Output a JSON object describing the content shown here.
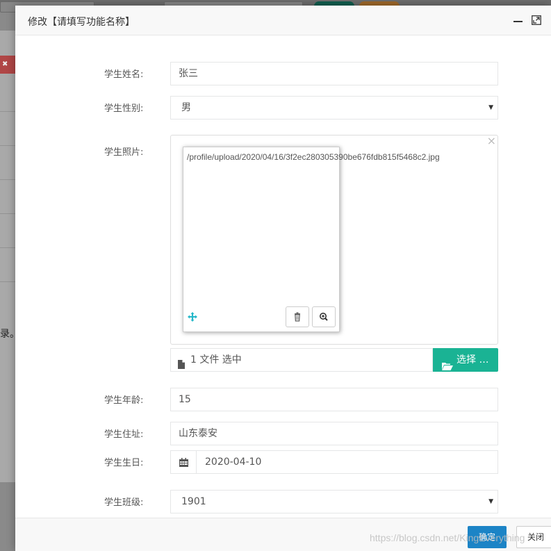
{
  "background": {
    "side_text": "录。",
    "side_badge_text": "✖"
  },
  "dialog": {
    "title": "修改【请填写功能名称】"
  },
  "form": {
    "name": {
      "label": "学生姓名:",
      "value": "张三"
    },
    "gender": {
      "label": "学生性别:",
      "value": "男"
    },
    "photo": {
      "label": "学生照片:",
      "file_path": "/profile/upload/2020/04/16/3f2ec280305390be676fdb815f5468c2.jpg",
      "caption": "1 文件 选中",
      "choose_label": "选择 …"
    },
    "age": {
      "label": "学生年龄:",
      "value": "15"
    },
    "address": {
      "label": "学生住址:",
      "value": "山东泰安"
    },
    "birthday": {
      "label": "学生生日:",
      "value": "2020-04-10"
    },
    "class": {
      "label": "学生班级:",
      "value": "1901"
    }
  },
  "footer": {
    "ok_label": "确定",
    "close_label": "关闭",
    "watermark": "https://blog.csdn.net/KingEverything"
  },
  "colors": {
    "primary": "#1c84c6",
    "success": "#1ab394",
    "overlay": "#8a8a8a"
  }
}
